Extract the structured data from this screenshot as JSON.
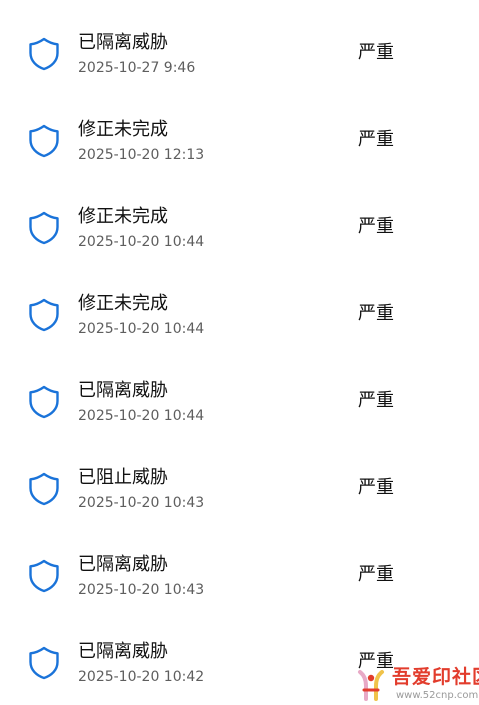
{
  "colors": {
    "shield_stroke": "#1a73d9",
    "title_text": "#111111",
    "time_text": "#5e5e5e",
    "watermark_red": "#e23c2c"
  },
  "threat_list": {
    "items": [
      {
        "icon": "shield-icon",
        "status": "已隔离威胁",
        "time": "2025-10-27 9:46",
        "severity": "严重"
      },
      {
        "icon": "shield-icon",
        "status": "修正未完成",
        "time": "2025-10-20 12:13",
        "severity": "严重"
      },
      {
        "icon": "shield-icon",
        "status": "修正未完成",
        "time": "2025-10-20 10:44",
        "severity": "严重"
      },
      {
        "icon": "shield-icon",
        "status": "修正未完成",
        "time": "2025-10-20 10:44",
        "severity": "严重"
      },
      {
        "icon": "shield-icon",
        "status": "已隔离威胁",
        "time": "2025-10-20 10:44",
        "severity": "严重"
      },
      {
        "icon": "shield-icon",
        "status": "已阻止威胁",
        "time": "2025-10-20 10:43",
        "severity": "严重"
      },
      {
        "icon": "shield-icon",
        "status": "已隔离威胁",
        "time": "2025-10-20 10:43",
        "severity": "严重"
      },
      {
        "icon": "shield-icon",
        "status": "已隔离威胁",
        "time": "2025-10-20 10:42",
        "severity": "严重"
      }
    ]
  },
  "watermark": {
    "name": "吾爱印社区",
    "url": "www.52cnp.com"
  }
}
